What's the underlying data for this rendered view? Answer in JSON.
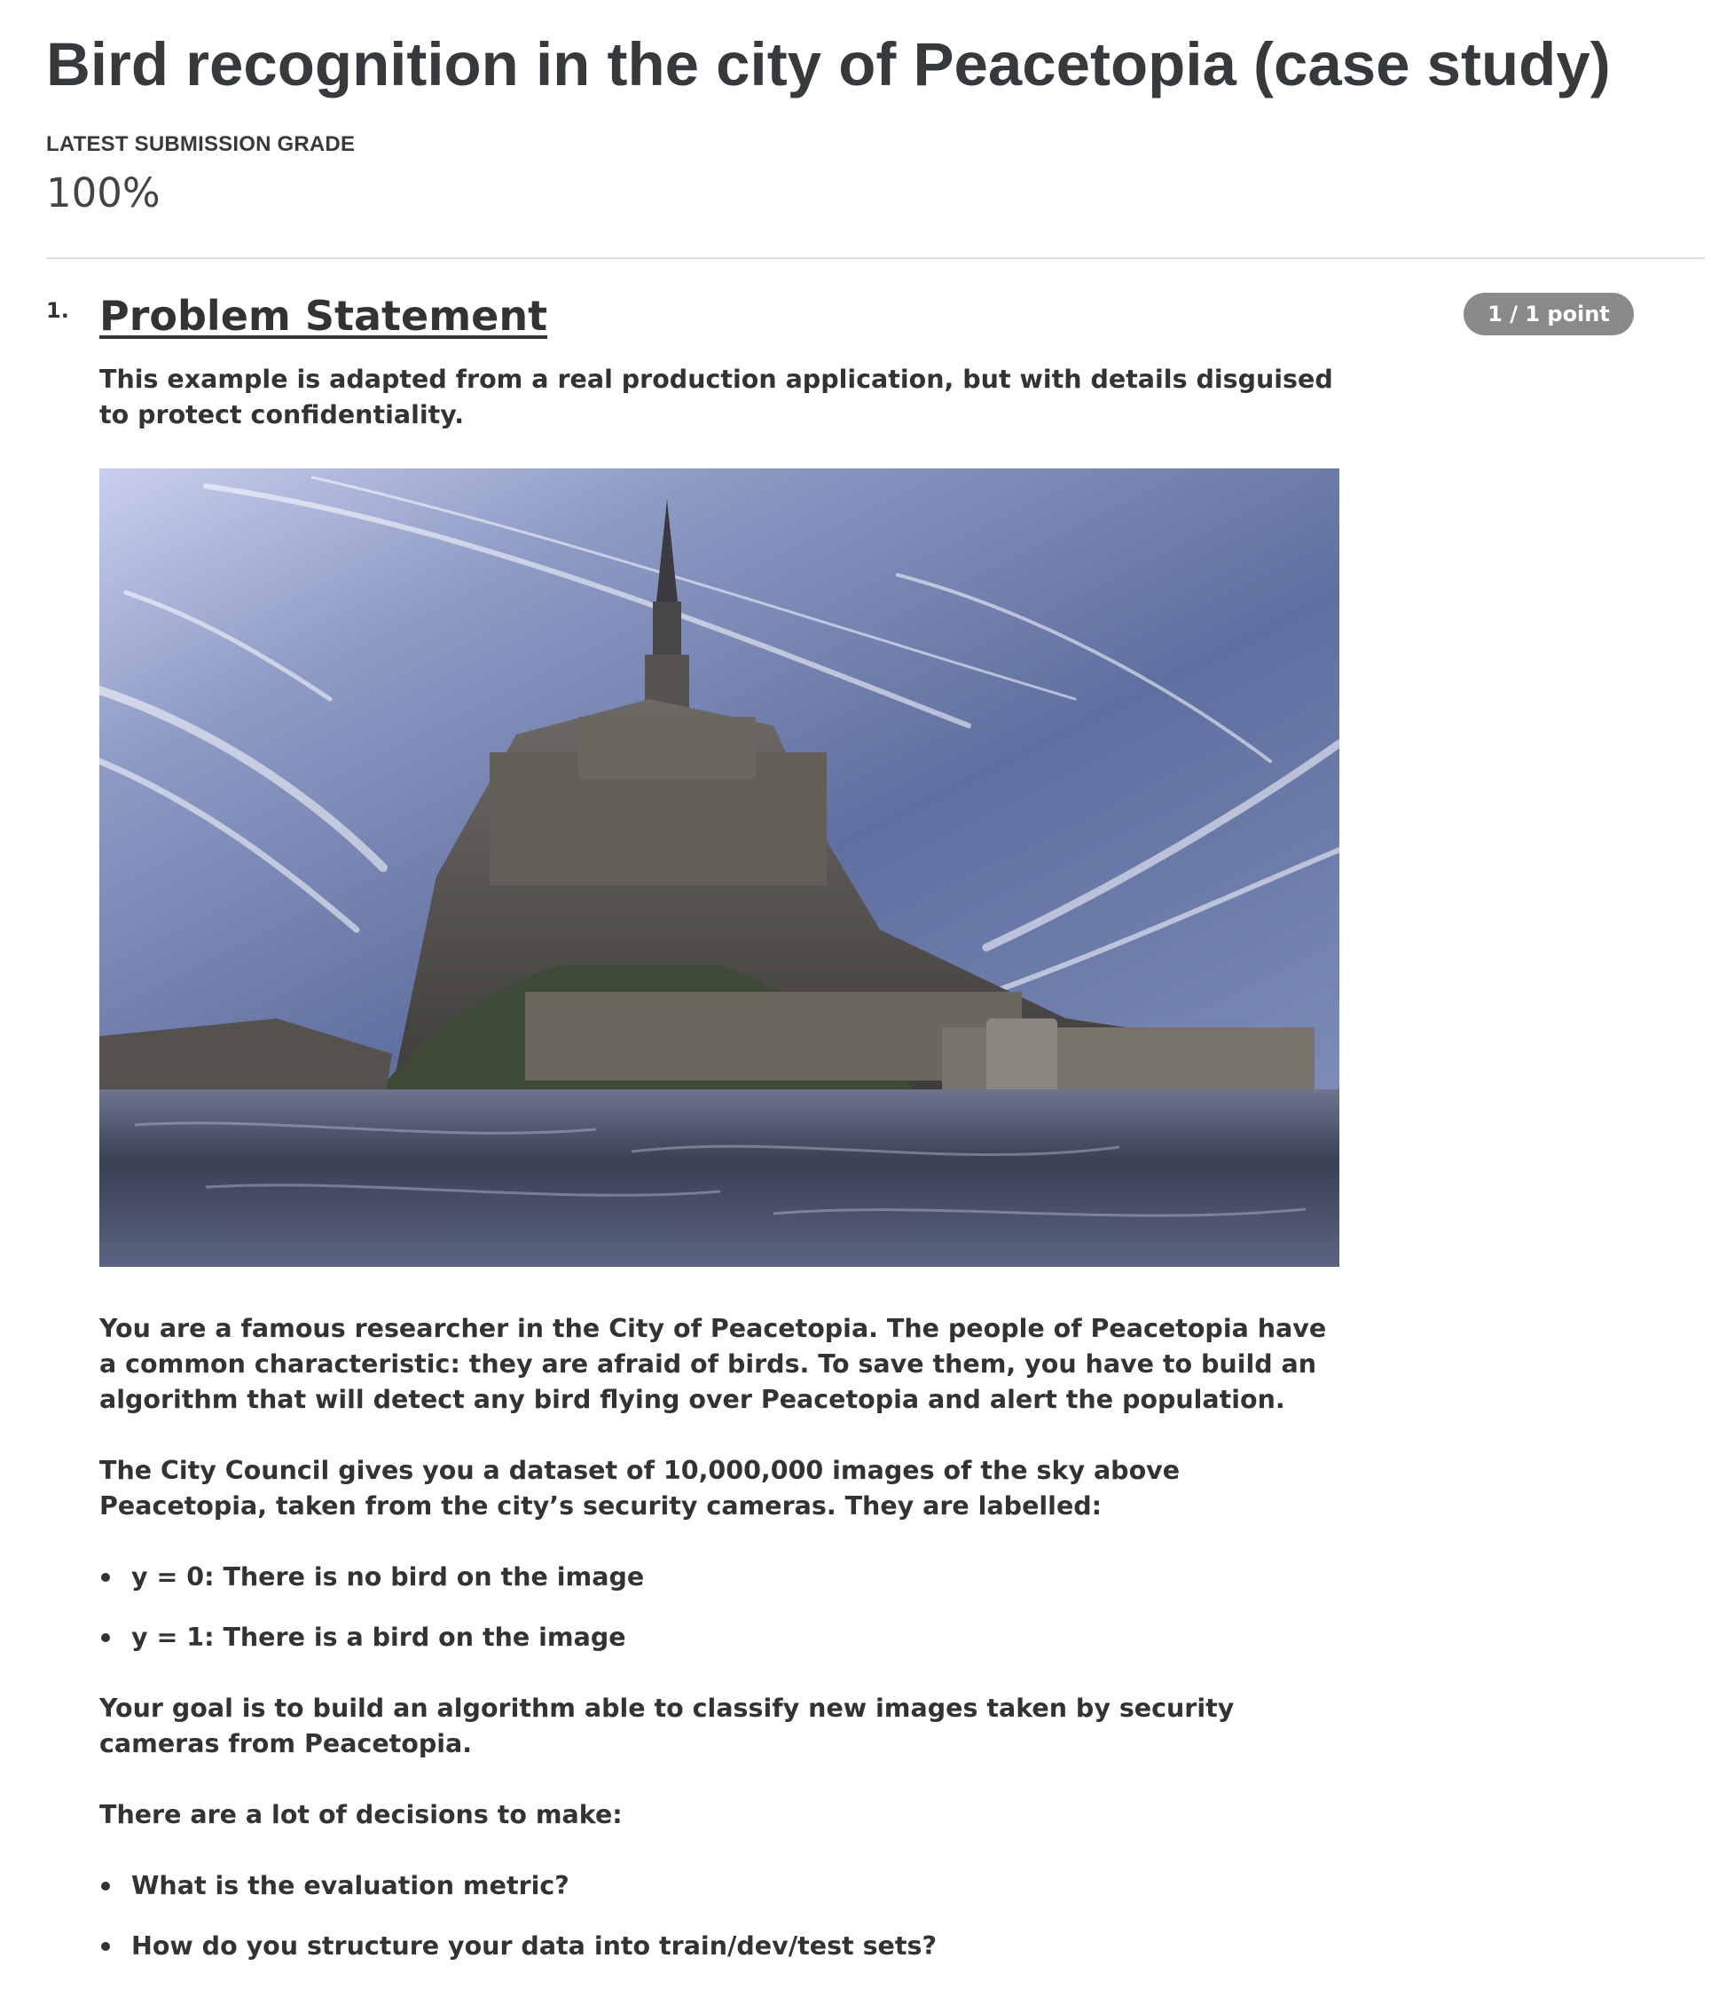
{
  "page": {
    "title": "Bird recognition in the city of Peacetopia (case study)",
    "grade_label": "LATEST SUBMISSION GRADE",
    "grade_value": "100%"
  },
  "question": {
    "number": "1.",
    "title": "Problem Statement",
    "points": "1 / 1 point",
    "intro": "This example is adapted from a real production application, but with details disguised to protect confidentiality.",
    "image": {
      "subject": "castle-island-photo",
      "colors": {
        "sky_top": "#5a6a9a",
        "sky_light": "#dfe3f5",
        "water": "#3d4356",
        "stone": "#5c5850"
      }
    },
    "paragraph_1": "You are a famous researcher in the City of Peacetopia. The people of Peacetopia have a common characteristic: they are afraid of birds. To save them, you have to build an algorithm that will detect any bird flying over Peacetopia and alert the population.",
    "paragraph_2": "The City Council gives you a dataset of 10,000,000 images of the sky above Peacetopia, taken from the city’s security cameras. They are labelled:",
    "labels": [
      "y = 0: There is no bird on the image",
      "y = 1: There is a bird on the image"
    ],
    "paragraph_3": "Your goal is to build an algorithm able to classify new images taken by security cameras from Peacetopia.",
    "paragraph_4": "There are a lot of decisions to make:",
    "decisions": [
      "What is the evaluation metric?",
      "How do you structure your data into train/dev/test sets?"
    ]
  },
  "colors": {
    "text": "#333333",
    "badge_bg": "#8a8a8a",
    "divider": "#dddddd"
  }
}
